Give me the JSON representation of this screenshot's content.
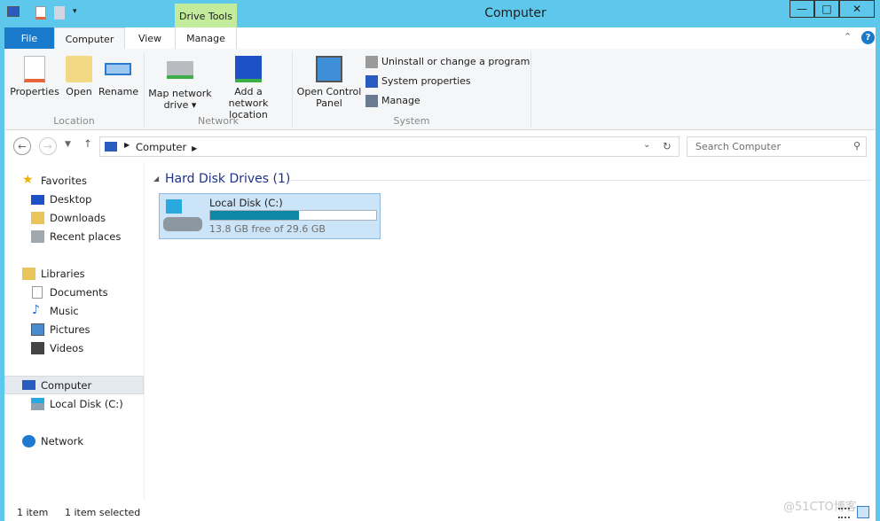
{
  "title": "Computer",
  "context_tab": "Drive Tools",
  "tabs": [
    "File",
    "Computer",
    "View",
    "Manage"
  ],
  "ribbon": {
    "location": {
      "label": "Location",
      "buttons": [
        "Properties",
        "Open",
        "Rename"
      ]
    },
    "network": {
      "label": "Network",
      "map": [
        "Map network",
        "drive ▾"
      ],
      "add": [
        "Add a network",
        "location"
      ]
    },
    "system": {
      "label": "System",
      "open_cp": [
        "Open Control",
        "Panel"
      ],
      "items": [
        "Uninstall or change a program",
        "System properties",
        "Manage"
      ]
    }
  },
  "address": {
    "path": "Computer"
  },
  "search": {
    "placeholder": "Search Computer"
  },
  "sidebar": {
    "favorites": "Favorites",
    "fav_items": [
      "Desktop",
      "Downloads",
      "Recent places"
    ],
    "libraries": "Libraries",
    "lib_items": [
      "Documents",
      "Music",
      "Pictures",
      "Videos"
    ],
    "computer": "Computer",
    "comp_items": [
      "Local Disk (C:)"
    ],
    "network": "Network"
  },
  "content": {
    "group": "Hard Disk Drives (1)",
    "drive": {
      "name": "Local Disk (C:)",
      "info": "13.8 GB free of 29.6 GB",
      "used_percent": 53.4,
      "bar_color": "#0d87a6"
    }
  },
  "status": {
    "count": "1 item",
    "selected": "1 item selected"
  },
  "watermark": "@51CTO博客",
  "colors": {
    "frame": "#5ec8ec",
    "file_tab": "#1979ca",
    "context": "#c2ec9c"
  }
}
